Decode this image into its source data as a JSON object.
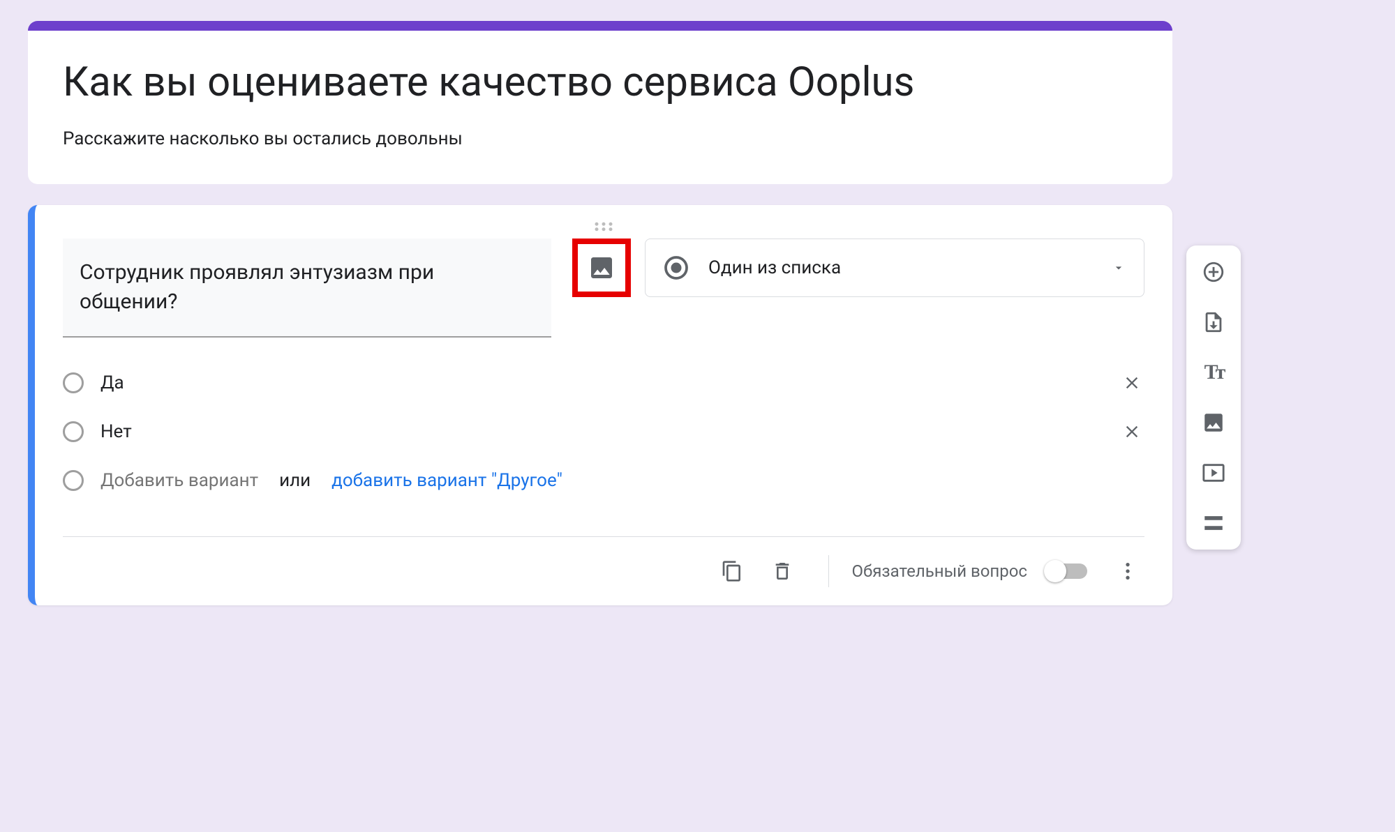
{
  "header": {
    "title": "Как вы оцениваете качество сервиса Ooplus",
    "description": "Расскажите насколько вы остались довольны"
  },
  "question": {
    "text": "Сотрудник проявлял энтузиазм при общении?",
    "type_label": "Один из списка",
    "options": [
      "Да",
      "Нет"
    ],
    "add_option_placeholder": "Добавить вариант",
    "add_separator": "или",
    "add_other_label": "добавить вариант \"Другое\""
  },
  "footer": {
    "required_label": "Обязательный вопрос",
    "required_on": false
  },
  "colors": {
    "accent": "#6d3fcc",
    "highlight": "#e60000",
    "link": "#1a73e8",
    "selection": "#4285f4"
  }
}
